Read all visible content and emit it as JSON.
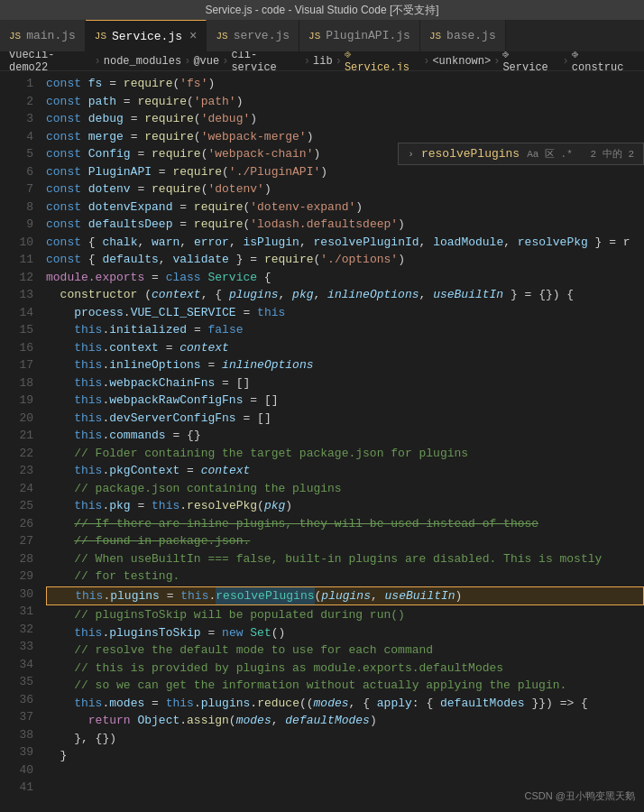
{
  "titlebar": {
    "text": "Service.js - code - Visual Studio Code [不受支持]"
  },
  "tabs": [
    {
      "id": "main-js",
      "label": "main.js",
      "active": false,
      "dirty": false
    },
    {
      "id": "service-js",
      "label": "Service.js",
      "active": true,
      "dirty": false
    },
    {
      "id": "serve-js",
      "label": "serve.js",
      "active": false,
      "dirty": false
    },
    {
      "id": "pluginapi-js",
      "label": "PluginAPI.js",
      "active": false,
      "dirty": false
    },
    {
      "id": "base-js",
      "label": "base.js",
      "active": false,
      "dirty": false
    }
  ],
  "breadcrumb": {
    "parts": [
      "vuecli-demo22",
      "node_modules",
      "@vue",
      "cli-service",
      "lib",
      "Service.js",
      "<unknown>",
      "Service",
      "construc"
    ]
  },
  "search": {
    "text": "resolvePlugins",
    "options": "Aa 区 .* 2 中的 2"
  },
  "watermark": "CSDN @丑小鸭变黑天鹅"
}
